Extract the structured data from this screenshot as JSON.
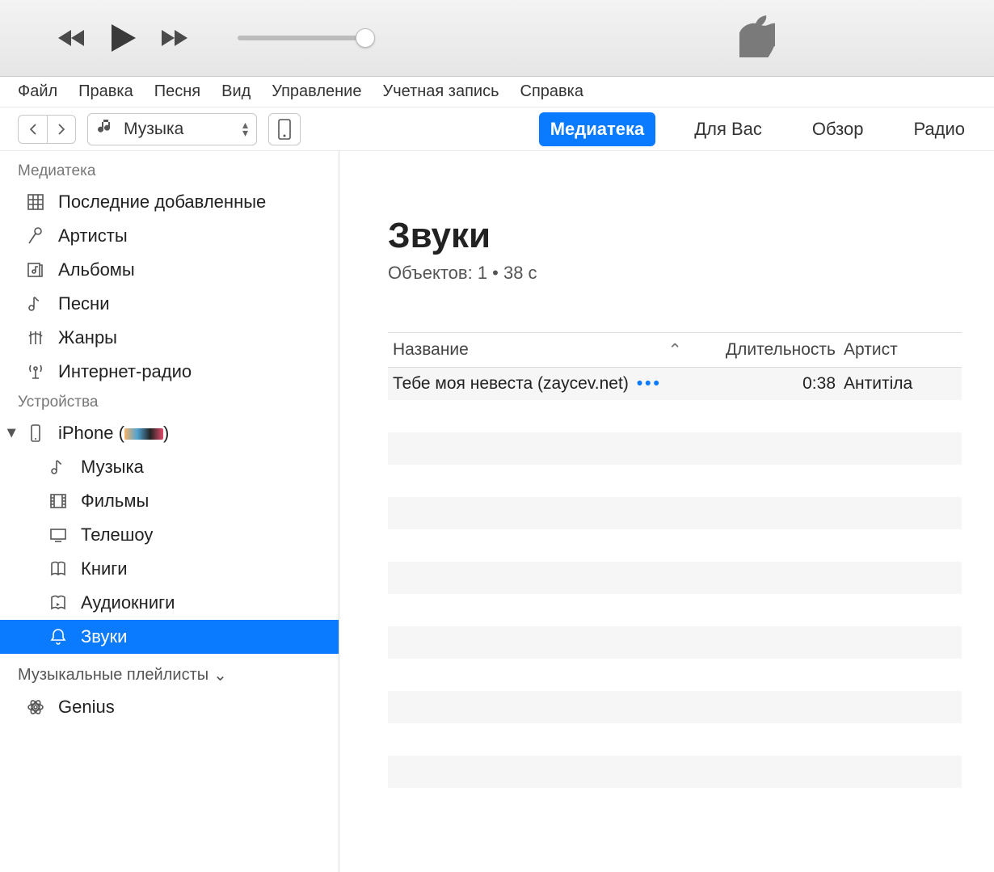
{
  "menubar": [
    "Файл",
    "Правка",
    "Песня",
    "Вид",
    "Управление",
    "Учетная запись",
    "Справка"
  ],
  "toolbar": {
    "source": "Музыка",
    "tabs": [
      {
        "label": "Медиатека",
        "active": true
      },
      {
        "label": "Для Вас",
        "active": false
      },
      {
        "label": "Обзор",
        "active": false
      },
      {
        "label": "Радио",
        "active": false
      }
    ]
  },
  "sidebar": {
    "library_header": "Медиатека",
    "library": [
      {
        "id": "recently-added",
        "label": "Последние добавленные",
        "icon": "grid"
      },
      {
        "id": "artists",
        "label": "Артисты",
        "icon": "mic"
      },
      {
        "id": "albums",
        "label": "Альбомы",
        "icon": "album"
      },
      {
        "id": "songs",
        "label": "Песни",
        "icon": "note"
      },
      {
        "id": "genres",
        "label": "Жанры",
        "icon": "guitar"
      },
      {
        "id": "radio",
        "label": "Интернет-радио",
        "icon": "antenna"
      }
    ],
    "devices_header": "Устройства",
    "device": {
      "label": "iPhone (",
      "suffix": ")"
    },
    "device_items": [
      {
        "id": "dev-music",
        "label": "Музыка",
        "icon": "note"
      },
      {
        "id": "dev-movies",
        "label": "Фильмы",
        "icon": "film"
      },
      {
        "id": "dev-tv",
        "label": "Телешоу",
        "icon": "tv"
      },
      {
        "id": "dev-books",
        "label": "Книги",
        "icon": "book"
      },
      {
        "id": "dev-audiobooks",
        "label": "Аудиокниги",
        "icon": "audiobook"
      },
      {
        "id": "dev-tones",
        "label": "Звуки",
        "icon": "bell",
        "selected": true
      }
    ],
    "playlists_header": "Музыкальные плейлисты",
    "genius": "Genius"
  },
  "content": {
    "title": "Звуки",
    "meta": "Объектов: 1 • 38 с",
    "columns": {
      "name": "Название",
      "duration": "Длительность",
      "artist": "Артист"
    },
    "rows": [
      {
        "name": "Тебе моя невеста (zaycev.net)",
        "duration": "0:38",
        "artist": "Антитіла"
      }
    ]
  }
}
